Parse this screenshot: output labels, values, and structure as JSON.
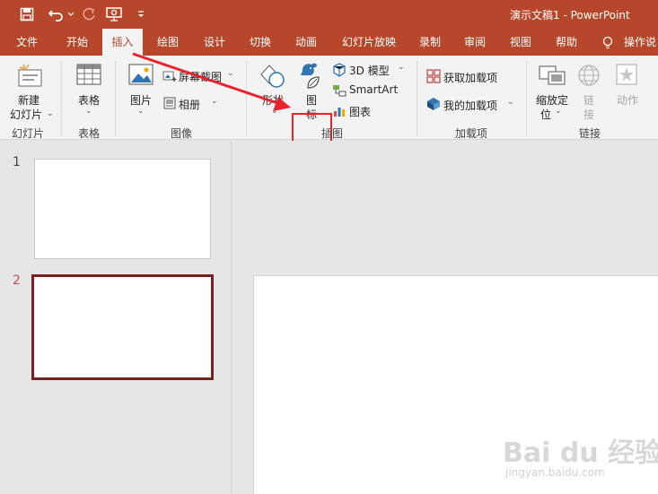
{
  "window": {
    "title": "演示文稿1  -  PowerPoint"
  },
  "quick_access": [
    "save-icon",
    "undo-icon",
    "redo-icon",
    "present-icon",
    "customize-icon"
  ],
  "tabs": [
    {
      "label": "文件"
    },
    {
      "label": "开始"
    },
    {
      "label": "插入",
      "active": true
    },
    {
      "label": "绘图"
    },
    {
      "label": "设计"
    },
    {
      "label": "切换"
    },
    {
      "label": "动画"
    },
    {
      "label": "幻灯片放映"
    },
    {
      "label": "录制"
    },
    {
      "label": "审阅"
    },
    {
      "label": "视图"
    },
    {
      "label": "帮助"
    }
  ],
  "tell_me": "操作说",
  "ribbon": {
    "new_slide_line1": "新建",
    "new_slide_line2": "幻灯片",
    "table": "表格",
    "picture": "图片",
    "screenshot": "屏幕截图",
    "album": "相册",
    "shapes": "形状",
    "icon_line1": "图",
    "icon_line2": "标",
    "model3d": "3D 模型",
    "smartart": "SmartArt",
    "chart": "图表",
    "get_addins": "获取加载项",
    "my_addins": "我的加载项",
    "zoom_line1": "缩放定",
    "zoom_line2": "位",
    "link_line1": "链",
    "link_line2": "接",
    "action": "动作"
  },
  "groups": {
    "slides": "幻灯片",
    "tables": "表格",
    "images": "图像",
    "illustrations": "插图",
    "addins": "加载项",
    "links": "链接"
  },
  "slides": [
    {
      "number": "1"
    },
    {
      "number": "2",
      "selected": true
    }
  ],
  "watermark": {
    "main": "Bai du 经验",
    "sub": "jingyan.baidu.com"
  },
  "colors": {
    "accent": "#b7472a",
    "highlight": "#e8232b",
    "selected_slide": "#7b1f1f"
  }
}
